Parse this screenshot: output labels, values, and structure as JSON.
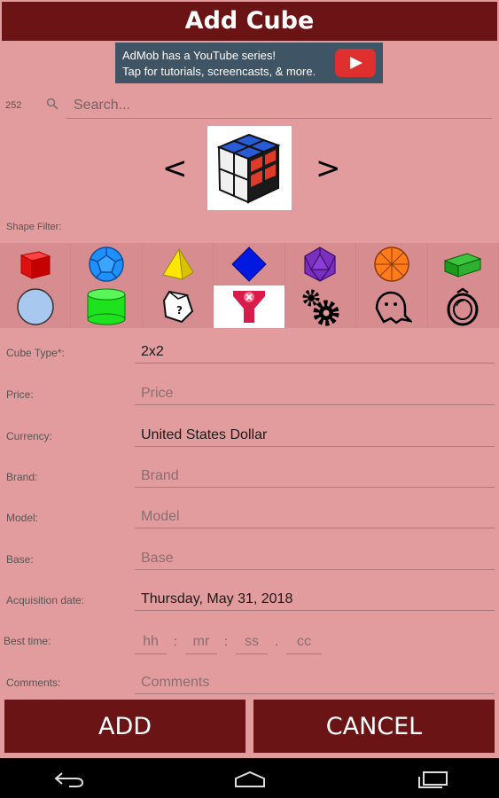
{
  "app": {
    "title": "Add Cube"
  },
  "ad": {
    "line1": "AdMob has a YouTube series!",
    "line2": "Tap for tutorials, screencasts, & more."
  },
  "search": {
    "count": "252",
    "placeholder": "Search..."
  },
  "carousel": {
    "prev": "<",
    "next": ">",
    "image": "2x2-cube-icon"
  },
  "shape_filter": {
    "label": "Shape Filter:",
    "icons": [
      "cube-red-icon",
      "dodecahedron-blue-icon",
      "tetrahedron-yellow-icon",
      "octahedron-blue-icon",
      "icosahedron-purple-icon",
      "ball-orange-icon",
      "cuboid-green-icon",
      "sphere-blue-icon",
      "cylinder-green-icon",
      "irregular-puzzle-icon",
      "megaminx-axis-icon",
      "gears-icon",
      "ghost-icon",
      "ring-icon"
    ],
    "selected": "megaminx-axis-icon"
  },
  "form": {
    "cube_type": {
      "label": "Cube Type*:",
      "value": "2x2"
    },
    "price": {
      "label": "Price:",
      "hint": "Price"
    },
    "currency": {
      "label": "Currency:",
      "value": "United States Dollar"
    },
    "brand": {
      "label": "Brand:",
      "hint": "Brand"
    },
    "model": {
      "label": "Model:",
      "hint": "Model"
    },
    "base": {
      "label": "Base:",
      "hint": "Base"
    },
    "acquisition_date": {
      "label": "Acquisition date:",
      "value": "Thursday, May 31, 2018"
    },
    "best_time": {
      "label": "Best time:",
      "hh": "hh",
      "mr": "mr",
      "ss": "ss",
      "cc": "cc",
      "sep1": ":",
      "sep2": ":",
      "sep3": "."
    },
    "comments": {
      "label": "Comments:",
      "hint": "Comments"
    }
  },
  "buttons": {
    "add": "ADD",
    "cancel": "CANCEL"
  },
  "colors": {
    "bar": "#6b1416",
    "background": "#e39c9e"
  }
}
